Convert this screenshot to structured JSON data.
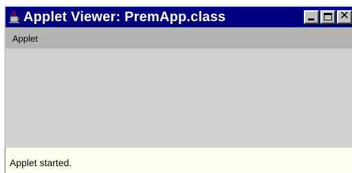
{
  "window": {
    "title": "Applet Viewer: PremApp.class",
    "icon": "java-cup-icon",
    "buttons": {
      "minimize": "minimize-icon",
      "maximize": "maximize-icon",
      "close": "✕"
    }
  },
  "menubar": {
    "items": [
      {
        "label": "Applet"
      }
    ]
  },
  "status": {
    "text": "Applet started."
  },
  "colors": {
    "titlebar": "#000080",
    "menubar": "#b4b4b4",
    "content": "#d0d0d0",
    "statusbar": "#fffff0"
  }
}
